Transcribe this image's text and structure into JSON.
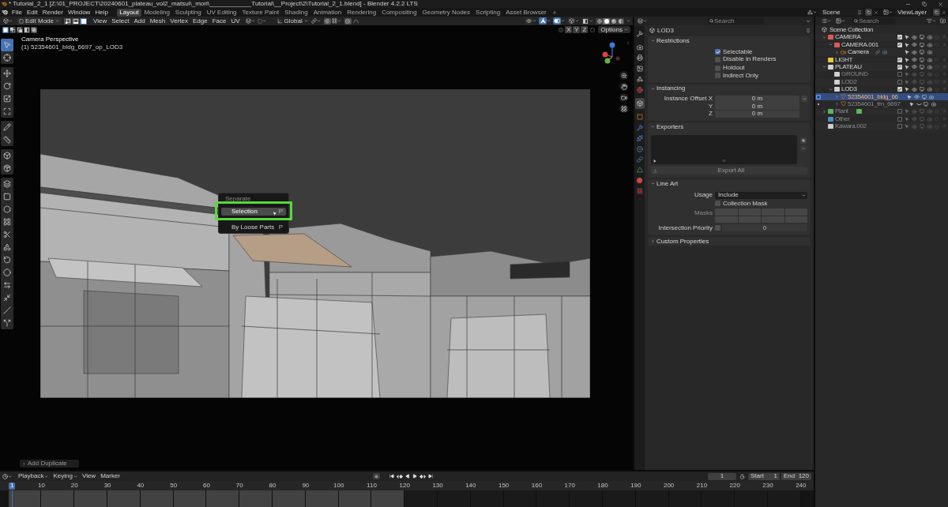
{
  "title_bar": {
    "title": "* Tutorial_2_1 [Z:\\01_PROJECT\\20240601_plateau_vol2_matsui\\_mori\\____________Tutorial\\__Project\\2\\Tutorial_2_1.blend] - Blender 4.2.2 LTS"
  },
  "top_bar": {
    "menus": [
      "File",
      "Edit",
      "Render",
      "Window",
      "Help"
    ],
    "workspaces": [
      {
        "label": "Layout",
        "selected": true
      },
      {
        "label": "Modeling",
        "selected": false
      },
      {
        "label": "Sculpting",
        "selected": false
      },
      {
        "label": "UV Editing",
        "selected": false
      },
      {
        "label": "Texture Paint",
        "selected": false
      },
      {
        "label": "Shading",
        "selected": false
      },
      {
        "label": "Animation",
        "selected": false
      },
      {
        "label": "Rendering",
        "selected": false
      },
      {
        "label": "Compositing",
        "selected": false
      },
      {
        "label": "Geometry Nodes",
        "selected": false
      },
      {
        "label": "Scripting",
        "selected": false
      },
      {
        "label": "Asset Browser",
        "selected": false
      }
    ],
    "scene": "Scene",
    "view_layer": "ViewLayer"
  },
  "viewport": {
    "header": {
      "mode": "Edit Mode",
      "select_modes": [
        {
          "kind": "vertex",
          "selected": false
        },
        {
          "kind": "edge",
          "selected": false
        },
        {
          "kind": "face",
          "selected": true
        }
      ],
      "menus": [
        "View",
        "Select",
        "Add",
        "Mesh",
        "Vertex",
        "Edge",
        "Face",
        "UV"
      ],
      "orientation": "Global",
      "view_toggles": [
        {
          "kind": "visibility",
          "active": false
        },
        {
          "kind": "gizmos",
          "active": true
        },
        {
          "kind": "overlays",
          "active": true
        },
        {
          "kind": "mesh_overlays",
          "active": false
        },
        {
          "kind": "xray",
          "active": false
        }
      ],
      "shading": [
        {
          "kind": "wireframe",
          "selected": false
        },
        {
          "kind": "solid",
          "selected": true
        },
        {
          "kind": "material",
          "selected": false
        },
        {
          "kind": "rendered",
          "selected": false
        }
      ]
    },
    "tool_settings": {
      "select_ops": [
        {
          "kind": "set",
          "selected": true
        },
        {
          "kind": "extend",
          "selected": false
        },
        {
          "kind": "subtract",
          "selected": false
        },
        {
          "kind": "invert",
          "selected": false
        },
        {
          "kind": "intersect",
          "selected": false
        }
      ],
      "mirror_axes": [
        {
          "label": "X",
          "selected": false
        },
        {
          "label": "Y",
          "selected": false
        },
        {
          "label": "Z",
          "selected": false
        }
      ],
      "options": "Options"
    },
    "info": [
      "Camera Perspective",
      "(1) 52354601_bldg_6697_op_LOD3"
    ],
    "tool_groups": [
      [
        {
          "kind": "select",
          "selected": true
        },
        {
          "kind": "cursor",
          "selected": false
        }
      ],
      [
        {
          "kind": "move",
          "selected": false
        },
        {
          "kind": "rotate",
          "selected": false
        },
        {
          "kind": "scale",
          "selected": false
        },
        {
          "kind": "transform",
          "selected": false
        }
      ],
      [
        {
          "kind": "annotate",
          "selected": false
        },
        {
          "kind": "measure",
          "selected": false
        }
      ],
      [
        {
          "kind": "add_cube",
          "selected": false
        },
        {
          "kind": "extrude_region",
          "selected": false
        }
      ],
      [
        {
          "kind": "extrude",
          "selected": false
        },
        {
          "kind": "inset",
          "selected": false
        },
        {
          "kind": "bevel",
          "selected": false
        },
        {
          "kind": "loop_cut",
          "selected": false
        },
        {
          "kind": "knife",
          "selected": false
        },
        {
          "kind": "poly_build",
          "selected": false
        },
        {
          "kind": "spin",
          "selected": false
        },
        {
          "kind": "smooth",
          "selected": false
        },
        {
          "kind": "edge_slide",
          "selected": false
        },
        {
          "kind": "shrink",
          "selected": false
        },
        {
          "kind": "shear",
          "selected": false
        },
        {
          "kind": "rip",
          "selected": false
        }
      ]
    ],
    "context_menu": {
      "title": "Separate",
      "items": [
        {
          "label": "Selection",
          "shortcut": "P",
          "selected": true
        },
        {
          "label": "By Loose Parts",
          "shortcut": "P",
          "selected": false
        }
      ]
    },
    "last_operator": "Add Duplicate"
  },
  "properties": {
    "search": {
      "placeholder": "Search"
    },
    "tab_groups": [
      [
        {
          "kind": "tool",
          "selected": false
        }
      ],
      [
        {
          "kind": "render",
          "selected": false
        },
        {
          "kind": "output",
          "selected": false
        },
        {
          "kind": "view_layer",
          "selected": false
        },
        {
          "kind": "scene",
          "selected": false
        },
        {
          "kind": "world",
          "selected": false
        }
      ],
      [
        {
          "kind": "collection",
          "selected": true
        }
      ],
      [
        {
          "kind": "object",
          "selected": false
        },
        {
          "kind": "modifiers",
          "selected": false
        },
        {
          "kind": "particles",
          "selected": false
        },
        {
          "kind": "physics",
          "selected": false
        },
        {
          "kind": "constraints",
          "selected": false
        },
        {
          "kind": "data",
          "selected": false
        },
        {
          "kind": "material",
          "selected": false
        },
        {
          "kind": "texture",
          "selected": false
        }
      ]
    ],
    "context": "LOD3",
    "panels": [
      {
        "kind": "restrictions",
        "title": "Restrictions",
        "expanded": true,
        "checkboxes": [
          {
            "label": "Selectable",
            "checked": true
          },
          {
            "label": "Disable in Renders",
            "checked": false
          },
          {
            "label": "Holdout",
            "checked": false
          },
          {
            "label": "Indirect Only",
            "checked": false
          }
        ]
      },
      {
        "kind": "instancing",
        "title": "Instancing",
        "expanded": true,
        "fields": [
          {
            "label": "Instance Offset X",
            "value": "0 m"
          },
          {
            "label": "Y",
            "value": "0 m"
          },
          {
            "label": "Z",
            "value": "0 m"
          }
        ]
      },
      {
        "kind": "exporters",
        "title": "Exporters",
        "expanded": true,
        "button": {
          "label": "Export All",
          "disabled": true
        }
      },
      {
        "kind": "line_art",
        "title": "Line Art",
        "expanded": true,
        "usage": {
          "label": "Usage",
          "value": "Include"
        },
        "mask": {
          "label": "Collection Mask",
          "checked": false
        },
        "masks": {
          "label": "Masks",
          "disabled": true,
          "toggles": [
            {
              "on": false
            },
            {
              "on": false
            },
            {
              "on": false
            },
            {
              "on": false
            },
            {
              "on": false
            },
            {
              "on": false
            },
            {
              "on": false
            },
            {
              "on": false
            }
          ]
        },
        "priority": {
          "label": "Intersection Priority",
          "checked": false,
          "value": "0"
        }
      },
      {
        "kind": "custom",
        "title": "Custom Properties",
        "expanded": false
      }
    ]
  },
  "outliner": {
    "search": {
      "placeholder": "Search"
    },
    "root": {
      "name": "Scene Collection",
      "selected": false,
      "children": [
        {
          "kind": "collection",
          "name": "CAMERA",
          "color": "#e05a5a",
          "expanded": true,
          "included": true,
          "selected": false,
          "visible": true,
          "children": [
            {
              "kind": "collection",
              "name": "CAMERA.001",
              "color": "#e05a5a",
              "expanded": true,
              "included": true,
              "selected": false,
              "visible": true,
              "children": [
                {
                  "kind": "camera",
                  "name": "Camera",
                  "expanded": false,
                  "selected": false,
                  "visible": true,
                  "inline_icons": [
                    {
                      "kind": "constraint"
                    },
                    {
                      "kind": "camera_data"
                    }
                  ]
                }
              ]
            }
          ]
        },
        {
          "kind": "collection",
          "name": "LIGHT",
          "color": "#e8c840",
          "included": true,
          "selected": false,
          "visible": true
        },
        {
          "kind": "collection",
          "name": "PLATEAU",
          "color": "#d0d0d0",
          "expanded": true,
          "included": true,
          "selected": false,
          "visible": true,
          "children": [
            {
              "kind": "collection",
              "name": "GROUND",
              "color": "#d0d0d0",
              "included": false,
              "selected": false,
              "visible": true
            },
            {
              "kind": "collection",
              "name": "LOD2",
              "color": "#d0d0d0",
              "included": false,
              "selected": false,
              "visible": true
            },
            {
              "kind": "collection",
              "name": "LOD3",
              "color": "#d0d0d0",
              "expanded": true,
              "included": true,
              "selected": false,
              "visible": true,
              "children": [
                {
                  "kind": "mesh",
                  "name": "52354601_bldg_66",
                  "expanded": false,
                  "selected": true,
                  "visible": true,
                  "edit_mode": true
                },
                {
                  "kind": "mesh",
                  "name": "52354601_frn_6697",
                  "expanded": false,
                  "selected": false,
                  "visible": false,
                  "edit_mode": false
                }
              ]
            }
          ]
        },
        {
          "kind": "collection",
          "name": "Plant",
          "color": "#5cb85c",
          "expanded": false,
          "included": false,
          "selected": false,
          "visible": true,
          "inline_icons": [
            {
              "kind": "collection",
              "color": "#5cb85c"
            }
          ]
        },
        {
          "kind": "collection",
          "name": "Other",
          "color": "#4a8fd0",
          "included": false,
          "selected": false,
          "visible": true
        },
        {
          "kind": "collection",
          "name": "Kawara.002",
          "color": "#d0d0d0",
          "included": false,
          "selected": false,
          "visible": true
        }
      ]
    }
  },
  "timeline": {
    "menus": [
      {
        "label": "Playback",
        "kind": "dropdown"
      },
      {
        "label": "Keying",
        "kind": "dropdown"
      },
      {
        "label": "View",
        "kind": "menu"
      },
      {
        "label": "Marker",
        "kind": "menu"
      }
    ],
    "auto_keying": false,
    "current_frame": "1",
    "start": {
      "label": "Start",
      "value": "1"
    },
    "end": {
      "label": "End",
      "value": "120"
    },
    "playhead": "1",
    "ticks": [
      {
        "label": "10",
        "in_range": true
      },
      {
        "label": "20",
        "in_range": true
      },
      {
        "label": "30",
        "in_range": true
      },
      {
        "label": "40",
        "in_range": true
      },
      {
        "label": "50",
        "in_range": true
      },
      {
        "label": "60",
        "in_range": true
      },
      {
        "label": "70",
        "in_range": true
      },
      {
        "label": "80",
        "in_range": true
      },
      {
        "label": "90",
        "in_range": true
      },
      {
        "label": "100",
        "in_range": true
      },
      {
        "label": "110",
        "in_range": true
      },
      {
        "label": "120",
        "in_range": true
      },
      {
        "label": "130",
        "in_range": false
      },
      {
        "label": "140",
        "in_range": false
      },
      {
        "label": "150",
        "in_range": false
      },
      {
        "label": "160",
        "in_range": false
      },
      {
        "label": "170",
        "in_range": false
      },
      {
        "label": "180",
        "in_range": false
      },
      {
        "label": "190",
        "in_range": false
      },
      {
        "label": "200",
        "in_range": false
      },
      {
        "label": "210",
        "in_range": false
      },
      {
        "label": "220",
        "in_range": false
      },
      {
        "label": "230",
        "in_range": false
      },
      {
        "label": "240",
        "in_range": false
      }
    ]
  }
}
